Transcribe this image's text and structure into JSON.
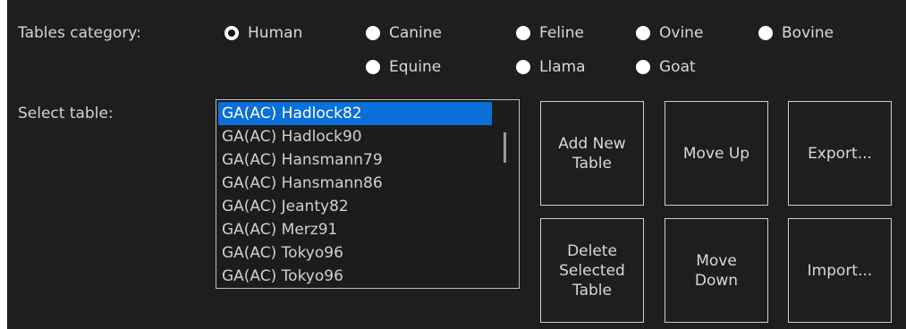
{
  "tables_category": {
    "label": "Tables category:",
    "options": [
      {
        "label": "Human",
        "checked": true
      },
      {
        "label": "Canine",
        "checked": false
      },
      {
        "label": "Feline",
        "checked": false
      },
      {
        "label": "Ovine",
        "checked": false
      },
      {
        "label": "Bovine",
        "checked": false
      },
      {
        "label": "Equine",
        "checked": false
      },
      {
        "label": "Llama",
        "checked": false
      },
      {
        "label": "Goat",
        "checked": false
      }
    ]
  },
  "select_table": {
    "label": "Select table:",
    "items": [
      "GA(AC) Hadlock82",
      "GA(AC) Hadlock90",
      "GA(AC) Hansmann79",
      "GA(AC) Hansmann86",
      "GA(AC) Jeanty82",
      "GA(AC) Merz91",
      "GA(AC) Tokyo96",
      "GA(AC) Tokyo96"
    ],
    "selected_index": 0
  },
  "buttons": {
    "add_new_table": "Add New\nTable",
    "move_up": "Move Up",
    "export": "Export...",
    "delete_selected_table": "Delete\nSelected\nTable",
    "move_down": "Move\nDown",
    "import": "Import..."
  },
  "colors": {
    "background": "#1e1e1e",
    "selection": "#0a6fd6",
    "border": "#cfcfcf"
  }
}
